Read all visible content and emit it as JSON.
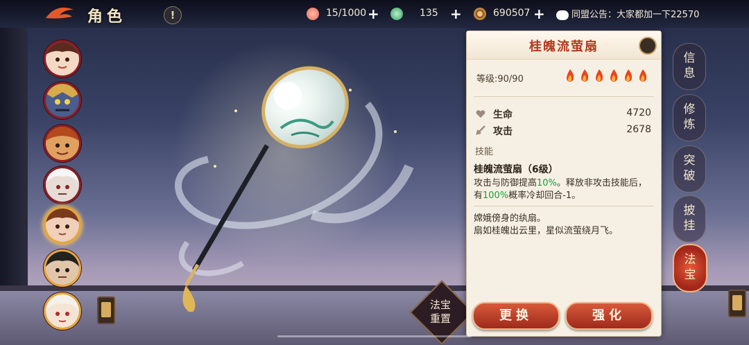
{
  "header": {
    "title": "角色",
    "help": "!"
  },
  "resources": {
    "stamina": {
      "value": "15/1000",
      "icon": "peach-icon"
    },
    "jade": {
      "value": "135",
      "icon": "swirl-gem-icon"
    },
    "coins": {
      "value": "690507",
      "icon": "coin-icon"
    },
    "announcement": "同盟公告：大家都加一下22570"
  },
  "characters": [
    {
      "name": "character-portrait-1",
      "active": false
    },
    {
      "name": "character-portrait-2",
      "active": false
    },
    {
      "name": "character-portrait-3",
      "active": false
    },
    {
      "name": "character-portrait-4",
      "active": false
    },
    {
      "name": "character-portrait-5",
      "active": true
    },
    {
      "name": "character-portrait-6",
      "active": false
    },
    {
      "name": "character-portrait-7",
      "active": false
    }
  ],
  "artifact": {
    "name": "桂魄流萤扇",
    "level": "等级:90/90",
    "stars": 6,
    "stats": [
      {
        "label": "生命",
        "value": "4720",
        "icon": "heart-icon"
      },
      {
        "label": "攻击",
        "value": "2678",
        "icon": "sword-icon"
      }
    ],
    "skill_section": "技能",
    "skill_title": "桂魄流萤扇（6级）",
    "skill_desc_1": "攻击与防御提高",
    "skill_hl_1": "10%",
    "skill_desc_2": "。释放非攻击技能后，有",
    "skill_hl_2": "100%",
    "skill_desc_3": "概率冷却回合-1。",
    "lore_1": "嫦娥傍身的纨扇。",
    "lore_2": "扇如桂魄出云里，星似流萤绕月飞。"
  },
  "actions": {
    "replace": "更换",
    "enhance": "强化",
    "reset_line1": "法宝",
    "reset_line2": "重置"
  },
  "tabs": [
    {
      "line1": "信",
      "line2": "息",
      "active": false
    },
    {
      "line1": "修",
      "line2": "炼",
      "active": false
    },
    {
      "line1": "突",
      "line2": "破",
      "active": false
    },
    {
      "line1": "披",
      "line2": "挂",
      "active": false
    },
    {
      "line1": "法",
      "line2": "宝",
      "active": true
    }
  ],
  "colors": {
    "accent_red": "#b13a1c",
    "highlight_green": "#1f9a3a",
    "gold": "#e6a63a"
  }
}
